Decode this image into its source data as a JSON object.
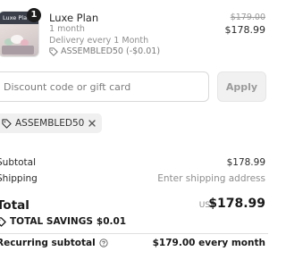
{
  "product": {
    "image_caption": "Luxe Pla",
    "quantity": "1",
    "name": "Luxe Plan",
    "line1": "1 month",
    "line2": "Delivery every 1 Month",
    "discount_line": "ASSEMBLED50 (-$0.01)",
    "price_original": "$179.00",
    "price_current": "$178.99"
  },
  "discount": {
    "placeholder": "Discount code or gift card",
    "apply_label": "Apply",
    "applied_code": "ASSEMBLED50"
  },
  "summary": {
    "subtotal_label": "Subtotal",
    "subtotal_value": "$178.99",
    "shipping_label": "Shipping",
    "shipping_value": "Enter shipping address",
    "total_label": "Total",
    "currency": "USD",
    "total_value": "$178.99",
    "savings_label": "TOTAL SAVINGS",
    "savings_value": "$0.01",
    "recurring_label": "Recurring subtotal",
    "recurring_value": "$179.00 every month"
  },
  "icons": {
    "tag": "tag-icon",
    "close": "close-icon",
    "savings": "savings-tag-icon",
    "help": "help-circle-icon"
  }
}
